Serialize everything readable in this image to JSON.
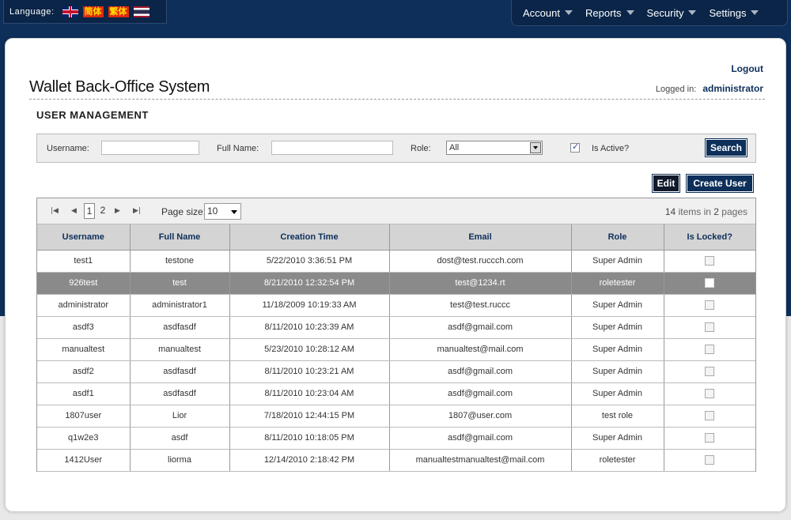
{
  "language_bar": {
    "label": "Language:",
    "flags": [
      {
        "name": "english-flag-icon",
        "text": ""
      },
      {
        "name": "simplified-chinese-flag-icon",
        "text": "简体"
      },
      {
        "name": "traditional-chinese-flag-icon",
        "text": "繁体"
      },
      {
        "name": "thai-flag-icon",
        "text": ""
      }
    ]
  },
  "nav": {
    "items": [
      "Account",
      "Reports",
      "Security",
      "Settings"
    ]
  },
  "header": {
    "logout": "Logout",
    "app_title": "Wallet Back-Office System",
    "logged_in_label": "Logged in:",
    "logged_in_user": "administrator"
  },
  "section_title": "USER MANAGEMENT",
  "search": {
    "username_label": "Username:",
    "username_value": "",
    "fullname_label": "Full Name:",
    "fullname_value": "",
    "role_label": "Role:",
    "role_value": "All",
    "is_active_label": "Is Active?",
    "is_active_checked": true,
    "search_button": "Search"
  },
  "actions": {
    "edit": "Edit",
    "create_user": "Create User"
  },
  "pager": {
    "pages": [
      "1",
      "2"
    ],
    "current_page": "1",
    "page_size_label": "Page size:",
    "page_size": "10",
    "total_items": "14",
    "items_in_text": "items in",
    "total_pages": "2",
    "pages_text": "pages"
  },
  "table": {
    "columns": [
      "Username",
      "Full Name",
      "Creation Time",
      "Email",
      "Role",
      "Is Locked?"
    ],
    "selected_row": 1,
    "rows": [
      {
        "username": "test1",
        "full_name": "testone",
        "created": "5/22/2010 3:36:51 PM",
        "email": "dost@test.ruccch.com",
        "role": "Super Admin"
      },
      {
        "username": "926test",
        "full_name": "test",
        "created": "8/21/2010 12:32:54 PM",
        "email": "test@1234.rt",
        "role": "roletester"
      },
      {
        "username": "administrator",
        "full_name": "administrator1",
        "created": "11/18/2009 10:19:33 AM",
        "email": "test@test.ruccc",
        "role": "Super Admin"
      },
      {
        "username": "asdf3",
        "full_name": "asdfasdf",
        "created": "8/11/2010 10:23:39 AM",
        "email": "asdf@gmail.com",
        "role": "Super Admin"
      },
      {
        "username": "manualtest",
        "full_name": "manualtest",
        "created": "5/23/2010 10:28:12 AM",
        "email": "manualtest@mail.com",
        "role": "Super Admin"
      },
      {
        "username": "asdf2",
        "full_name": "asdfasdf",
        "created": "8/11/2010 10:23:21 AM",
        "email": "asdf@gmail.com",
        "role": "Super Admin"
      },
      {
        "username": "asdf1",
        "full_name": "asdfasdf",
        "created": "8/11/2010 10:23:04 AM",
        "email": "asdf@gmail.com",
        "role": "Super Admin"
      },
      {
        "username": "1807user",
        "full_name": "Lior",
        "created": "7/18/2010 12:44:15 PM",
        "email": "1807@user.com",
        "role": "test role"
      },
      {
        "username": "q1w2e3",
        "full_name": "asdf",
        "created": "8/11/2010 10:18:05 PM",
        "email": "asdf@gmail.com",
        "role": "Super Admin"
      },
      {
        "username": "1412User",
        "full_name": "liorma",
        "created": "12/14/2010 2:18:42 PM",
        "email": "manualtestmanualtest@mail.com",
        "role": "roletester"
      }
    ]
  },
  "colors": {
    "navy": "#0d2f5a",
    "selected_row": "#8a8a8a",
    "header_bg": "#d4d4d4"
  }
}
